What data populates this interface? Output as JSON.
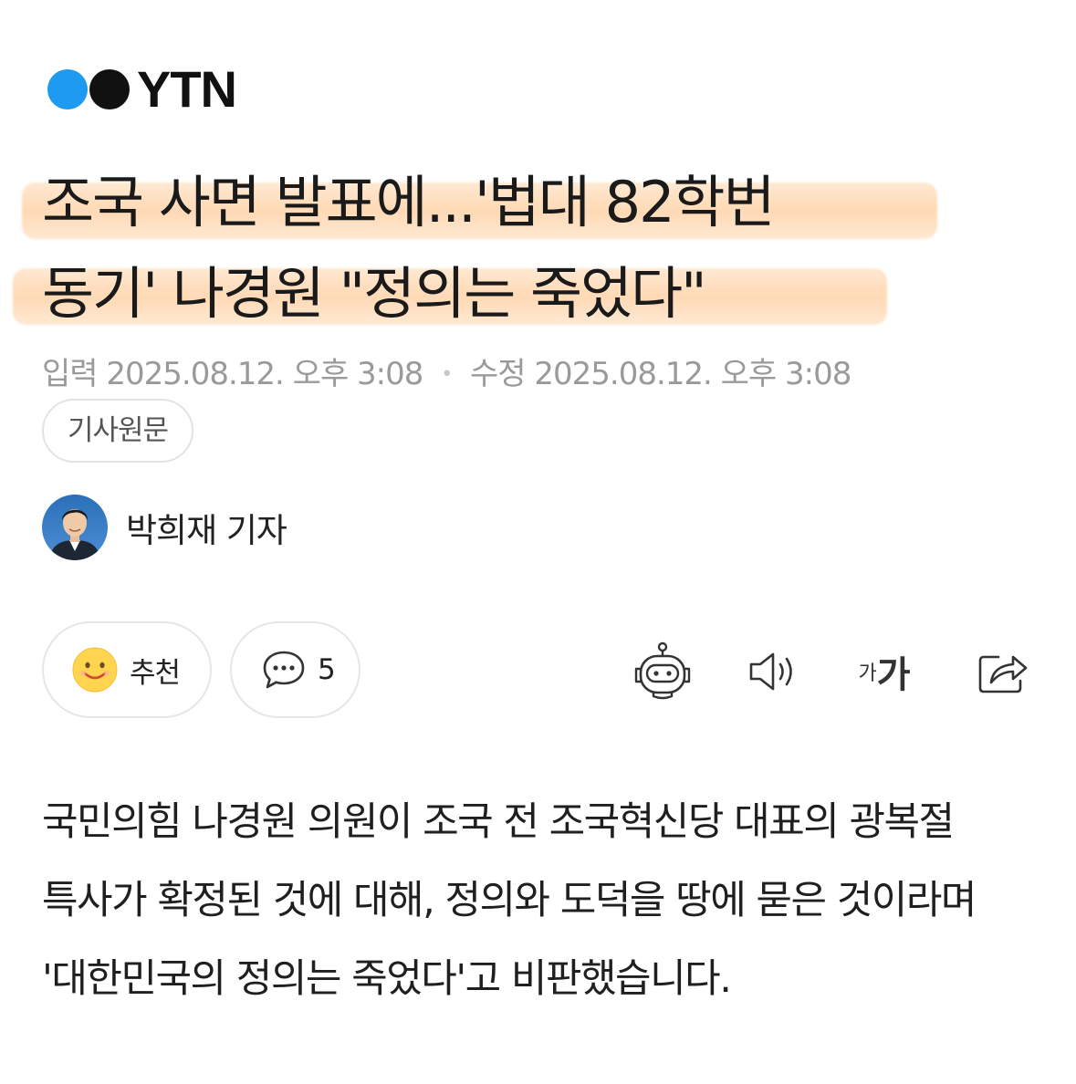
{
  "brand": {
    "logo_text": "YTN",
    "colors": {
      "dot_blue": "#1e9bf0",
      "dot_black": "#111111"
    }
  },
  "article": {
    "headline_line1": "조국 사면 발표에...'법대 82학번",
    "headline_line2": "동기' 나경원 \"정의는 죽었다\"",
    "highlight_color": "#ffd9b5",
    "input_label": "입력",
    "input_time": "2025.08.12. 오후 3:08",
    "modified_label": "수정",
    "modified_time": "2025.08.12. 오후 3:08",
    "separator": "•",
    "source_button": "기사원문",
    "author": "박희재 기자",
    "body": "국민의힘 나경원 의원이 조국 전 조국혁신당 대표의 광복절 특사가 확정된 것에 대해, 정의와 도덕을 땅에 묻은 것이라며 '대한민국의 정의는 죽었다'고 비판했습니다."
  },
  "actions": {
    "recommend_label": "추천",
    "recommend_icon": "smiley-face-icon",
    "comment_count": "5",
    "comment_icon": "speech-bubble-icon",
    "summary_icon": "robot-icon",
    "tts_icon": "speaker-icon",
    "font_small": "가",
    "font_big": "가",
    "share_icon": "share-icon"
  }
}
